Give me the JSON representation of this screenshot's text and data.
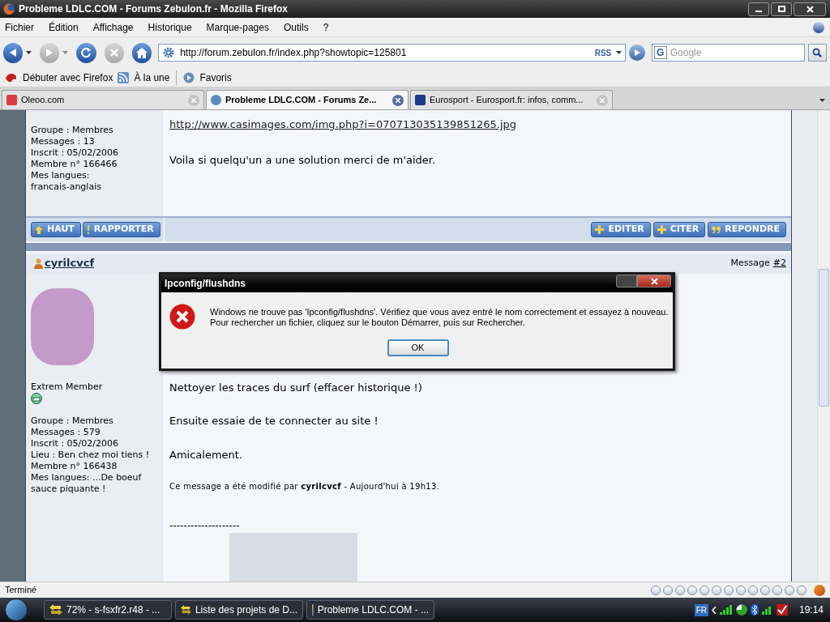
{
  "window": {
    "title": "Probleme LDLC.COM - Forums Zebulon.fr - Mozilla Firefox"
  },
  "menu": [
    "Fichier",
    "Édition",
    "Affichage",
    "Historique",
    "Marque-pages",
    "Outils",
    "?"
  ],
  "address_bar": {
    "url": "http://forum.zebulon.fr/index.php?showtopic=125801",
    "feed_label": "RSS"
  },
  "search": {
    "placeholder": "Google",
    "engine_badge": "G"
  },
  "bookmarks": [
    "Débuter avec Firefox",
    "À la une",
    "Favoris"
  ],
  "tabs": [
    {
      "label": "Oleoo.com",
      "selected": false
    },
    {
      "label": "Probleme LDLC.COM - Forums Ze...",
      "selected": true
    },
    {
      "label": "Eurosport - Eurosport.fr: infos, comm...",
      "selected": false
    }
  ],
  "posts": [
    {
      "profile": [
        "Groupe : Membres",
        "Messages : 13",
        "Inscrit : 05/02/2006",
        "Membre n° 166466",
        "Mes langues:",
        "francais-anglais"
      ],
      "link": "http://www.casimages.com/img.php?i=070713035139851265.jpg",
      "paragraphs": [
        "Voila si quelqu'un a une solution merci de m'aider."
      ],
      "left_buttons": [
        "HAUT",
        "RAPPORTER"
      ],
      "right_buttons": [
        "EDITER",
        "CITER",
        "REPONDRE"
      ]
    },
    {
      "author": "cyrilcvcf",
      "message_label": "Message",
      "message_number": "#2",
      "rank": "Extrem Member",
      "profile": [
        "Groupe : Membres",
        "Messages : 579",
        "Inscrit : 05/02/2006",
        "Lieu : Ben chez moi tiens !",
        "Membre n° 166438",
        "Mes langues: ...De boeuf sauce piquante !"
      ],
      "paragraphs": [
        "Nettoyer les traces du surf (effacer historique !)",
        "Ensuite essaie de te connecter au site !",
        "Amicalement."
      ],
      "edit_note": "Ce message a été modifié par **cyrilcvcf** - Aujourd'hui à 19h13.",
      "signature_separator": "--------------------"
    }
  ],
  "dialog": {
    "title": "Ipconfig/flushdns",
    "lines": [
      "Windows ne trouve pas 'Ipconfig/flushdns'. Vérifiez que vous avez entré le nom correctement et essayez à nouveau.",
      "Pour rechercher un fichier, cliquez sur le bouton Démarrer, puis sur Rechercher."
    ],
    "button": "OK"
  },
  "status_bar": {
    "text": "Terminé"
  },
  "taskbar": {
    "items": [
      {
        "label": "72% - s-fsxfr2.r48 - ...",
        "kind": "transfer"
      },
      {
        "label": "Liste des projets de D...",
        "kind": "transfer"
      },
      {
        "label": "Probleme LDLC.COM - ...",
        "kind": "browser"
      }
    ],
    "language": "FR",
    "clock": "19:14"
  }
}
